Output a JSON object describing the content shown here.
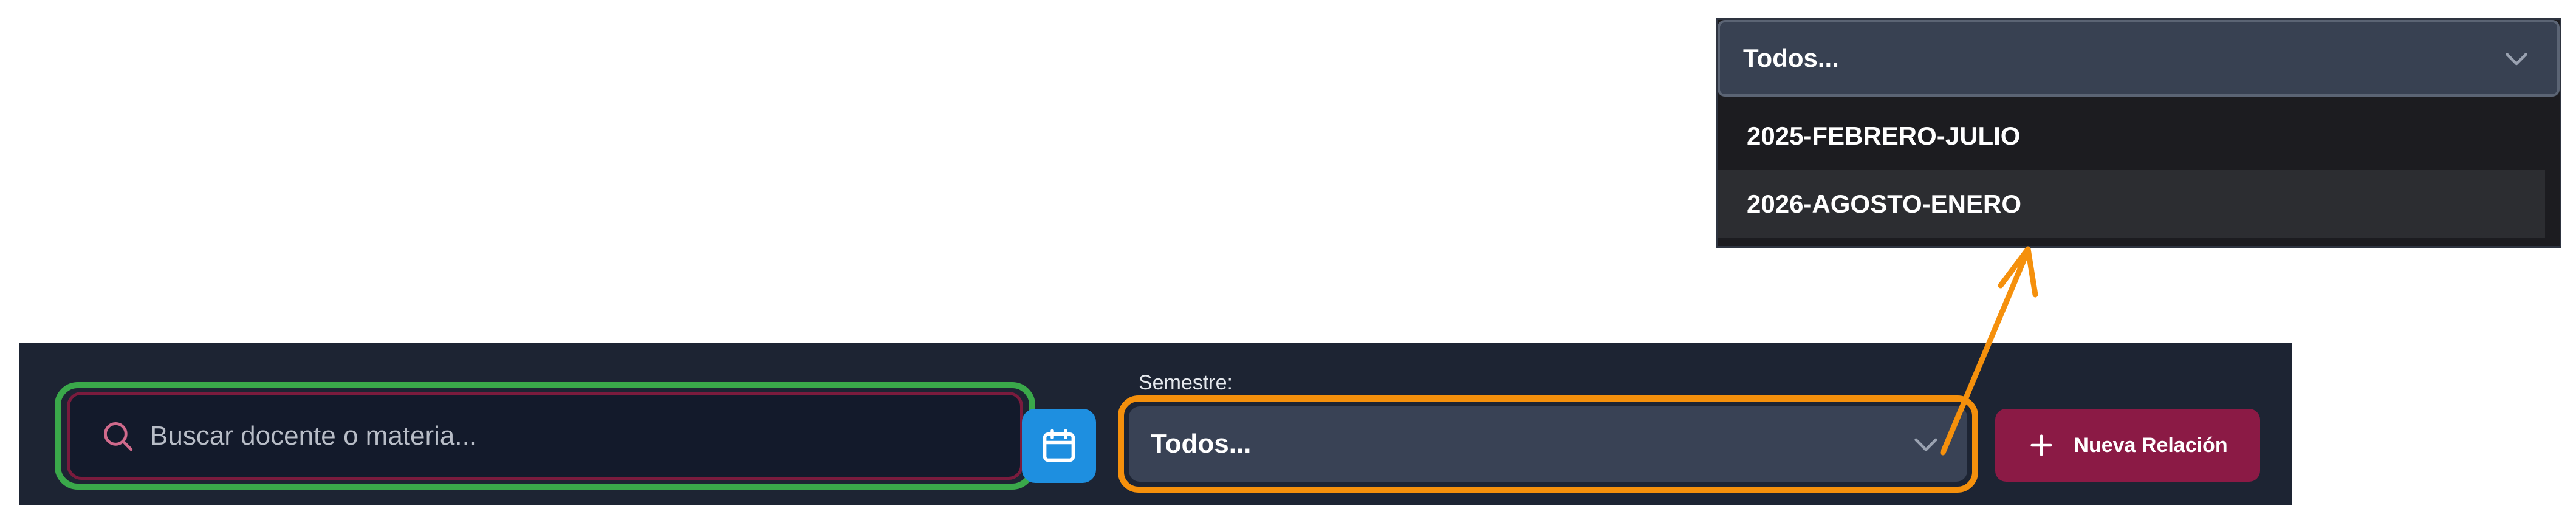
{
  "zoom": {
    "select_label": "Todos...",
    "options": [
      {
        "label": "2025-FEBRERO-JULIO"
      },
      {
        "label": "2026-AGOSTO-ENERO"
      }
    ],
    "hovered_option": "2026-AGOSTO-ENERO"
  },
  "toolbar": {
    "search": {
      "placeholder": "Buscar docente o materia...",
      "value": ""
    },
    "semester": {
      "label": "Semestre:",
      "value": "Todos..."
    },
    "new_button_label": "Nueva Relación"
  },
  "icons": {
    "search": "search-icon",
    "calendar": "calendar-icon",
    "chevron": "chevron-down-icon",
    "plus": "plus-icon"
  },
  "colors": {
    "toolbar_bg": "#1d2433",
    "search_highlight": "#3aa84a",
    "select_highlight": "#f5900c",
    "accent_primary": "#8b1a45",
    "calendar_button": "#1e8fe0",
    "select_bg": "#394255"
  }
}
